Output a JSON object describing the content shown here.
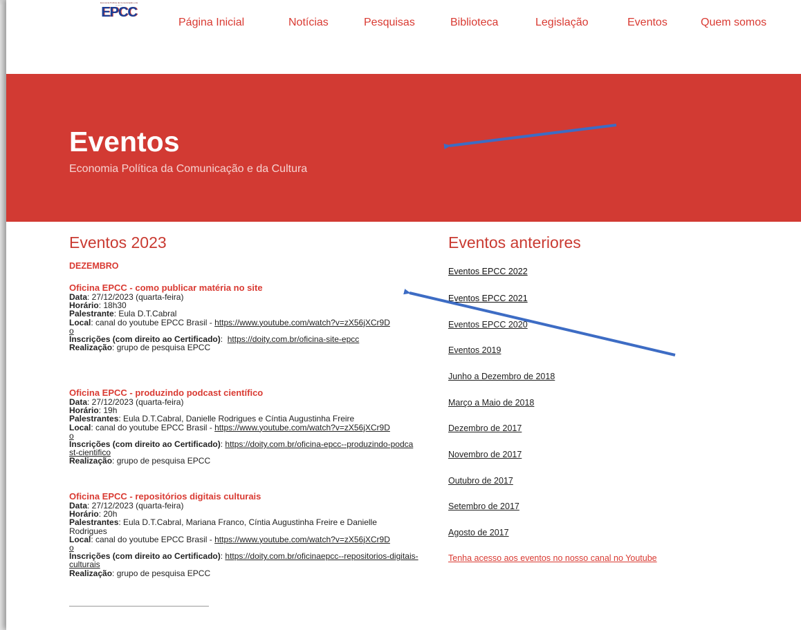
{
  "logo": {
    "small_text": "Economia Política da Comunicação e da Cultura",
    "text": "EPCC"
  },
  "nav": [
    "Página Inicial",
    "Notícias",
    "Pesquisas",
    "Biblioteca",
    "Legislação",
    "Eventos",
    "Quem somos"
  ],
  "banner": {
    "title": "Eventos",
    "subtitle": "Economia Política da Comunicação e da Cultura"
  },
  "left": {
    "heading": "Eventos 2023",
    "month": "DEZEMBRO",
    "events": [
      {
        "title": "Oficina EPCC - como publicar matéria no site",
        "data_label": "Data",
        "data": ": 27/12/2023 (quarta-feira)",
        "horario_label": "Horário",
        "horario": ": 18h30",
        "palestrante_label": "Palestrante",
        "palestrante": ": Eula D.T.Cabral",
        "local_label": "Local",
        "local": ": canal do youtube EPCC Brasil - ",
        "local_link": "https://www.youtube.com/watch?v=zX56jXCr9Do",
        "inscricoes_label": "Inscrições (com direito ao Certificado)",
        "inscricoes_sep": ":  ",
        "inscricoes_link": "https://doity.com.br/oficina-site-epcc",
        "realizacao_label": "Realização",
        "realizacao": ": grupo de pesquisa EPCC"
      },
      {
        "title": "Oficina EPCC - produzindo podcast científico",
        "data_label": "Data",
        "data": ": 27/12/2023 (quarta-feira)",
        "horario_label": "Horário",
        "horario": ": 19h",
        "palestrante_label": "Palestrantes",
        "palestrante": ": Eula D.T.Cabral, Danielle Rodrigues e Cíntia Augustinha Freire",
        "local_label": "Local",
        "local": ": canal do youtube EPCC Brasil - ",
        "local_link": "https://www.youtube.com/watch?v=zX56jXCr9Do",
        "inscricoes_label": "Inscrições (com direito ao Certificado)",
        "inscricoes_sep": ": ",
        "inscricoes_link": "https://doity.com.br/oficina-epcc--produzindo-podcast-cientifico",
        "realizacao_label": "Realização",
        "realizacao": ": grupo de pesquisa EPCC"
      },
      {
        "title": "Oficina EPCC - repositórios digitais culturais",
        "data_label": "Data",
        "data": ": 27/12/2023 (quarta-feira)",
        "horario_label": "Horário",
        "horario": ": 20h",
        "palestrante_label": "Palestrantes",
        "palestrante": ": Eula D.T.Cabral, Mariana Franco, Cíntia Augustinha Freire e Danielle Rodrigues",
        "local_label": "Local",
        "local": ": canal do youtube EPCC Brasil - ",
        "local_link": "https://www.youtube.com/watch?v=zX56jXCr9Do",
        "inscricoes_label": "Inscrições (com direito ao Certificado)",
        "inscricoes_sep": ": ",
        "inscricoes_link": "https://doity.com.br/oficinaepcc--repositorios-digitais-culturais",
        "realizacao_label": "Realização",
        "realizacao": ": grupo de pesquisa EPCC"
      }
    ]
  },
  "right": {
    "heading": "Eventos anteriores",
    "links": [
      "Eventos EPCC 2022",
      "Eventos EPCC 2021",
      "Eventos EPCC 2020",
      "Eventos 2019",
      "Junho a Dezembro de 2018",
      "Março a Maio de 2018",
      "Dezembro de 2017",
      "Novembro de 2017",
      "Outubro de 2017",
      "Setembro de 2017",
      "Agosto de 2017"
    ],
    "youtube_link": "Tenha acesso aos eventos no nosso canal no Youtube"
  },
  "colors": {
    "brand_red": "#d23a33",
    "arrow_blue": "#3d6cc4"
  }
}
